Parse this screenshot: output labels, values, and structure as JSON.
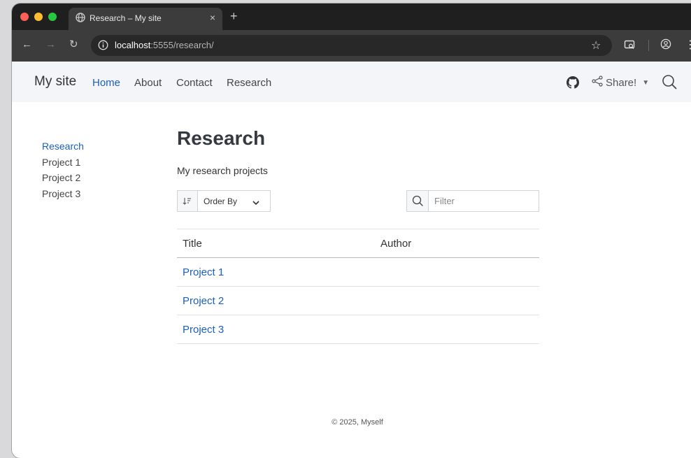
{
  "browser": {
    "tab_title": "Research – My site",
    "tab_close": "×",
    "new_tab": "+",
    "url_host": "localhost",
    "url_path": ":5555/research/",
    "icons": [
      "globe-icon",
      "back-icon",
      "forward-icon",
      "reload-icon",
      "info-icon",
      "star-icon",
      "lens-icon",
      "profile-icon",
      "menu-icon"
    ]
  },
  "navbar": {
    "brand": "My site",
    "links": [
      "Home",
      "About",
      "Contact",
      "Research"
    ],
    "active": "Home",
    "share_label": "Share!"
  },
  "sidebar": {
    "items": [
      {
        "label": "Research",
        "active": true
      },
      {
        "label": "Project 1",
        "active": false
      },
      {
        "label": "Project 2",
        "active": false
      },
      {
        "label": "Project 3",
        "active": false
      }
    ]
  },
  "main": {
    "title": "Research",
    "description": "My research projects",
    "sort_label": "Order By",
    "filter_placeholder": "Filter",
    "columns": [
      "Title",
      "Author"
    ],
    "rows": [
      {
        "title": "Project 1",
        "author": ""
      },
      {
        "title": "Project 2",
        "author": ""
      },
      {
        "title": "Project 3",
        "author": ""
      }
    ]
  },
  "footer": {
    "text": "© 2025, Myself"
  },
  "colors": {
    "link": "#1b5fbf",
    "navbar_bg": "#f4f5f9",
    "chrome_dark": "#1f1f1f"
  }
}
